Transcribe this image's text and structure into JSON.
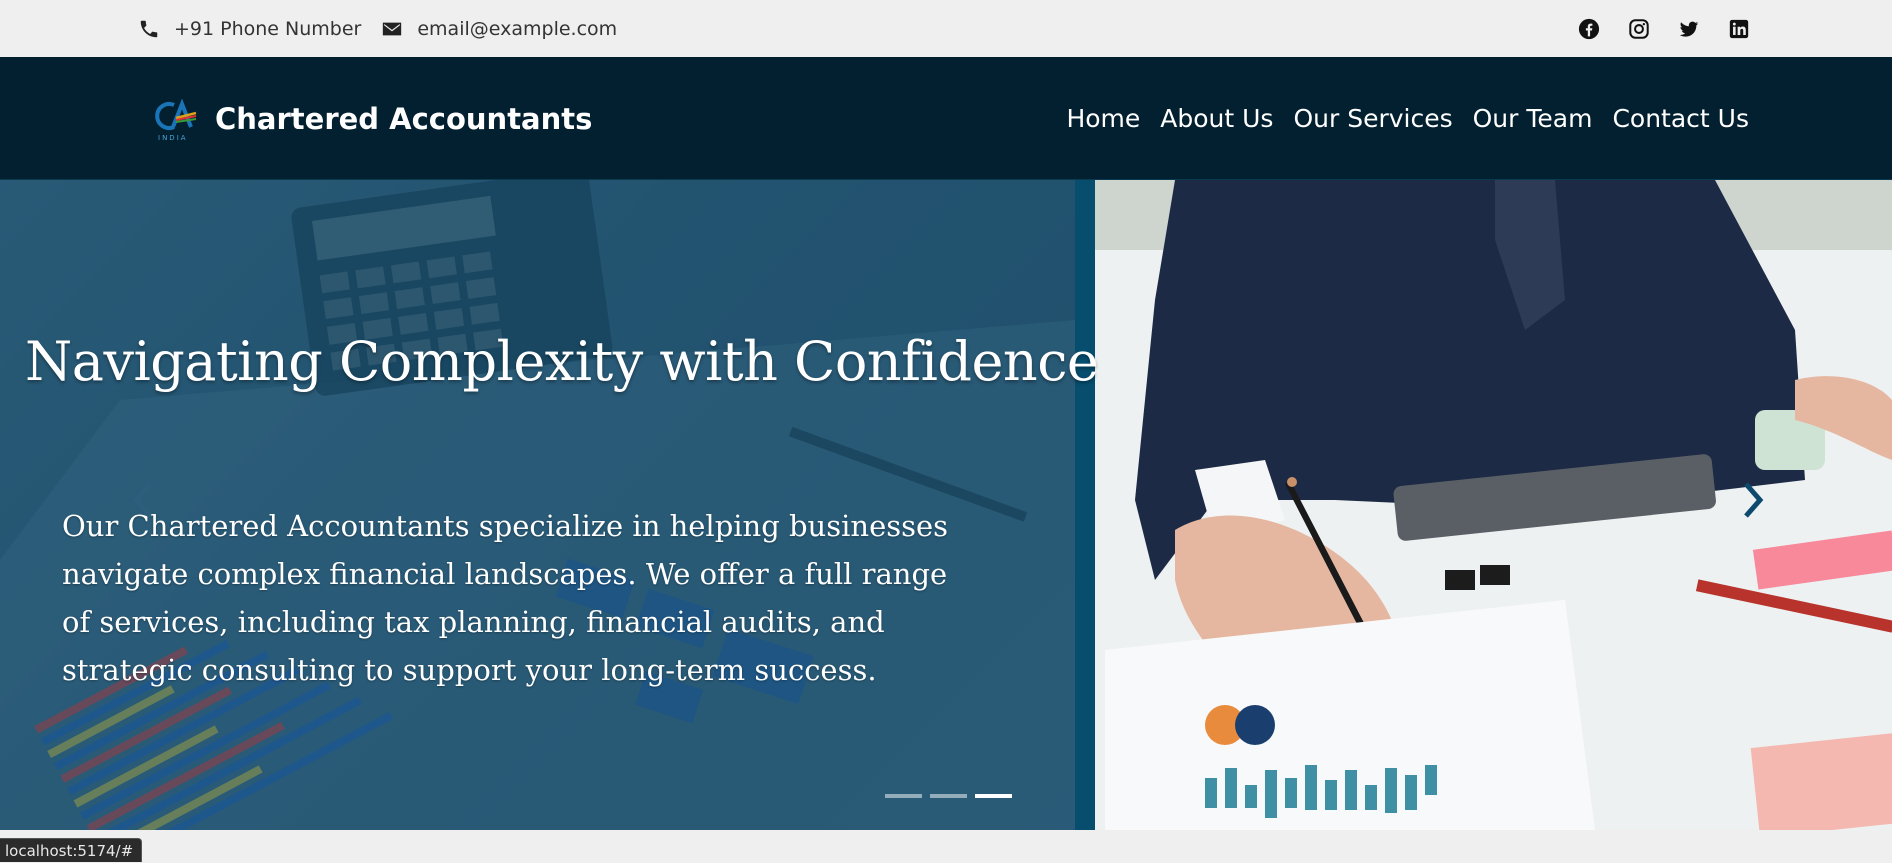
{
  "topbar": {
    "phone": "+91 Phone Number",
    "email": "email@example.com",
    "social_icons": [
      "facebook-icon",
      "instagram-icon",
      "twitter-icon",
      "linkedin-icon"
    ]
  },
  "header": {
    "brand_name": "Chartered Accountants",
    "logo_text": "INDIA",
    "nav": [
      "Home",
      "About Us",
      "Our Services",
      "Our Team",
      "Contact Us"
    ]
  },
  "hero": {
    "headline": "Navigating Complexity with Confidence",
    "description": "Our Chartered Accountants specialize in helping businesses navigate complex financial landscapes. We offer a full range of services, including tax planning, financial audits, and strategic consulting to support your long-term success.",
    "slide_count": 3,
    "active_slide": 3
  },
  "status": {
    "url": "localhost:5174/#"
  },
  "colors": {
    "header_bg": "#032030",
    "topbar_bg": "#efefef",
    "accent": "#064d6e"
  }
}
